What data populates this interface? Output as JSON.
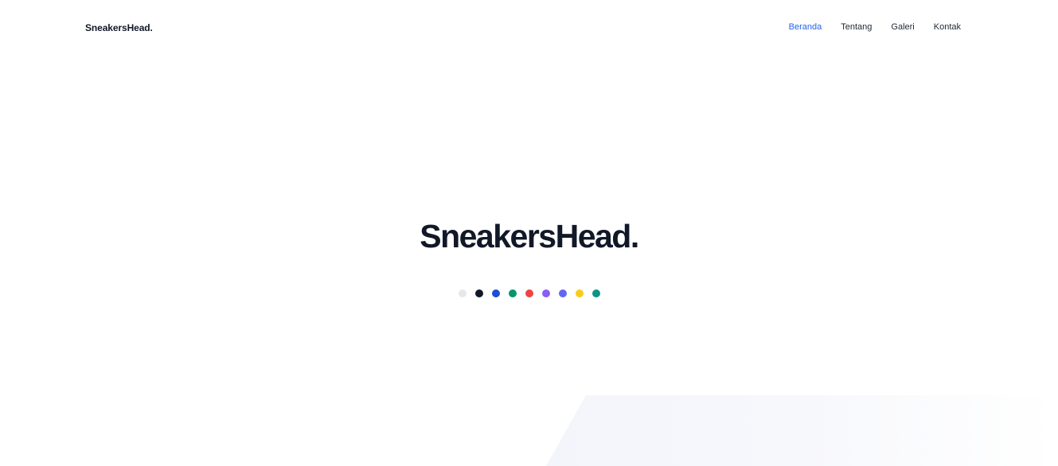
{
  "header": {
    "brand": "SneakersHead.",
    "nav": [
      {
        "label": "Beranda",
        "active": true
      },
      {
        "label": "Tentang",
        "active": false
      },
      {
        "label": "Galeri",
        "active": false
      },
      {
        "label": "Kontak",
        "active": false
      }
    ]
  },
  "hero": {
    "title": "SneakersHead.",
    "color_options": [
      "#e5e7eb",
      "#111827",
      "#1d4ed8",
      "#059669",
      "#ef4444",
      "#8b5cf6",
      "#6366f1",
      "#facc15",
      "#0d9488"
    ]
  },
  "colors": {
    "accent": "#2563eb",
    "text": "#111827"
  }
}
